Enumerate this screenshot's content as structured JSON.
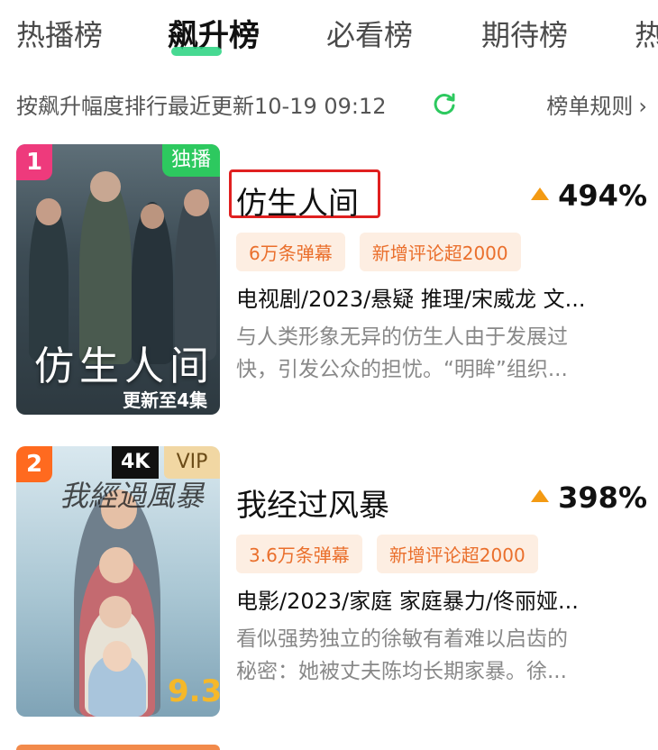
{
  "tabs": [
    "热播榜",
    "飙升榜",
    "必看榜",
    "期待榜",
    "热"
  ],
  "subheader": {
    "text": "按飙升幅度排行最近更新10-19 09:12",
    "rules_label": "榜单规则"
  },
  "items": [
    {
      "rank": "1",
      "badge": "独播",
      "title": "仿生人间",
      "percent": "494%",
      "tags": [
        "6万条弹幕",
        "新增评论超2000"
      ],
      "meta": "电视剧/2023/悬疑 推理/宋威龙 文...",
      "desc": [
        "与人类形象无异的仿生人由于发展过",
        "快，引发公众的担忧。“明眸”组织..."
      ],
      "poster_title": "仿生人间",
      "poster_sub": "更新至4集"
    },
    {
      "rank": "2",
      "badges": [
        "4K",
        "VIP"
      ],
      "title": "我经过风暴",
      "percent": "398%",
      "tags": [
        "3.6万条弹幕",
        "新增评论超2000"
      ],
      "meta": "电影/2023/家庭 家庭暴力/佟丽娅...",
      "desc": [
        "看似强势独立的徐敏有着难以启齿的",
        "秘密：她被丈夫陈均长期家暴。徐..."
      ],
      "poster_score": "9.3"
    }
  ],
  "colors": {
    "accent_green": "#27d27f",
    "arrow_orange": "#f39a13",
    "tag_bg": "#fdeee2",
    "tag_text": "#ea6f2c",
    "highlight_box": "#e02020"
  }
}
